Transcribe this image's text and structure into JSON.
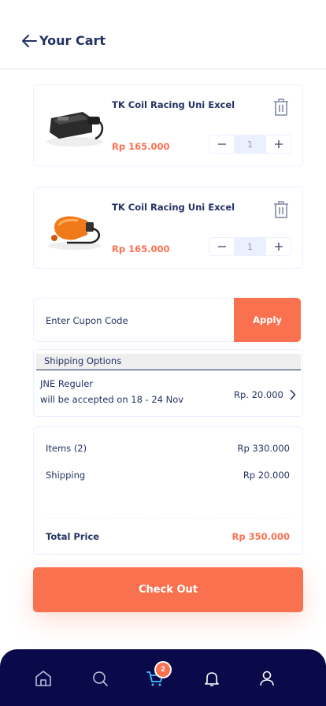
{
  "header": {
    "title": "Your Cart"
  },
  "cart": {
    "items": [
      {
        "name": "TK Coil Racing Uni Excel",
        "price": "Rp 165.000",
        "quantity": "1"
      },
      {
        "name": "TK Coil Racing Uni Excel",
        "price": "Rp 165.000",
        "quantity": "1"
      }
    ]
  },
  "coupon": {
    "placeholder": "Enter Cupon Code",
    "apply_label": "Apply"
  },
  "shipping": {
    "title": "Shipping Options",
    "courier": "JNE Reguler",
    "estimate": "will be accepted on 18 - 24 Nov",
    "price": "Rp. 20.000"
  },
  "summary": {
    "items_label": "Items (2)",
    "items_value": "Rp 330.000",
    "shipping_label": "Shipping",
    "shipping_value": "Rp 20.000",
    "total_label": "Total Price",
    "total_value": "Rp 350.000"
  },
  "checkout_label": "Check Out",
  "nav": {
    "items": [
      "home-icon",
      "search-icon",
      "cart-icon",
      "bell-icon",
      "user-icon"
    ],
    "cart_badge": "2",
    "active": "cart"
  },
  "colors": {
    "accent": "#fa7150",
    "primary_text": "#223263",
    "nav_bg": "#0a0a4a",
    "nav_active": "#40bfff",
    "qty_bg": "#ebf0ff"
  }
}
